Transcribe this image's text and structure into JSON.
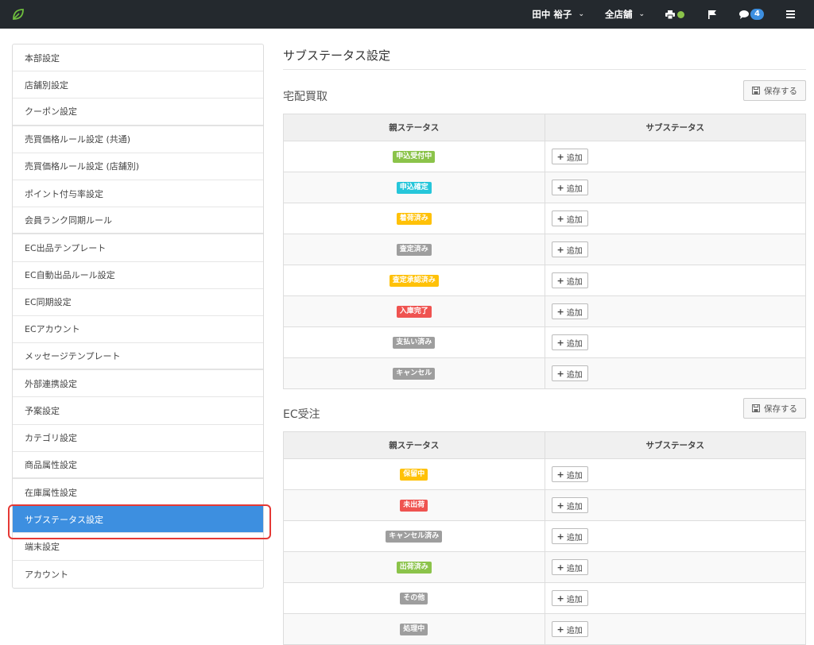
{
  "header": {
    "user": "田中 裕子",
    "store": "全店舗",
    "notifications": "4",
    "colors": {
      "bar": "#24292e",
      "badge": "#3d8fe0",
      "status_dot": "#8bc34a"
    }
  },
  "sidebar": {
    "items": [
      {
        "label": "本部設定"
      },
      {
        "label": "店舗別設定"
      },
      {
        "label": "クーポン設定"
      },
      {
        "label": "売買価格ルール設定 (共通)"
      },
      {
        "label": "売買価格ルール設定 (店舗別)"
      },
      {
        "label": "ポイント付与率設定"
      },
      {
        "label": "会員ランク同期ルール"
      },
      {
        "label": "EC出品テンプレート"
      },
      {
        "label": "EC自動出品ルール設定"
      },
      {
        "label": "EC同期設定"
      },
      {
        "label": "ECアカウント"
      },
      {
        "label": "メッセージテンプレート"
      },
      {
        "label": "外部連携設定"
      },
      {
        "label": "予案設定"
      },
      {
        "label": "カテゴリ設定"
      },
      {
        "label": "商品属性設定"
      },
      {
        "label": "在庫属性設定"
      },
      {
        "label": "サブステータス設定"
      },
      {
        "label": "端末設定"
      },
      {
        "label": "アカウント"
      }
    ],
    "active": "サブステータス設定"
  },
  "main": {
    "title": "サブステータス設定",
    "sections": [
      {
        "title": "宅配買取",
        "save_label": "保存する",
        "columns": [
          "親ステータス",
          "サブステータス"
        ],
        "add_label": "追加",
        "rows": [
          {
            "status": "申込受付中",
            "color": "#8bc34a"
          },
          {
            "status": "申込確定",
            "color": "#26c6da"
          },
          {
            "status": "着荷済み",
            "color": "#ffc107"
          },
          {
            "status": "査定済み",
            "color": "#9e9e9e"
          },
          {
            "status": "査定承認済み",
            "color": "#ffc107"
          },
          {
            "status": "入庫完了",
            "color": "#ef5350"
          },
          {
            "status": "支払い済み",
            "color": "#9e9e9e"
          },
          {
            "status": "キャンセル",
            "color": "#9e9e9e"
          }
        ]
      },
      {
        "title": "EC受注",
        "save_label": "保存する",
        "columns": [
          "親ステータス",
          "サブステータス"
        ],
        "add_label": "追加",
        "rows": [
          {
            "status": "保留中",
            "color": "#ffc107"
          },
          {
            "status": "未出荷",
            "color": "#ef5350"
          },
          {
            "status": "キャンセル済み",
            "color": "#9e9e9e"
          },
          {
            "status": "出荷済み",
            "color": "#8bc34a"
          },
          {
            "status": "その他",
            "color": "#9e9e9e"
          },
          {
            "status": "処理中",
            "color": "#9e9e9e"
          }
        ]
      }
    ]
  }
}
